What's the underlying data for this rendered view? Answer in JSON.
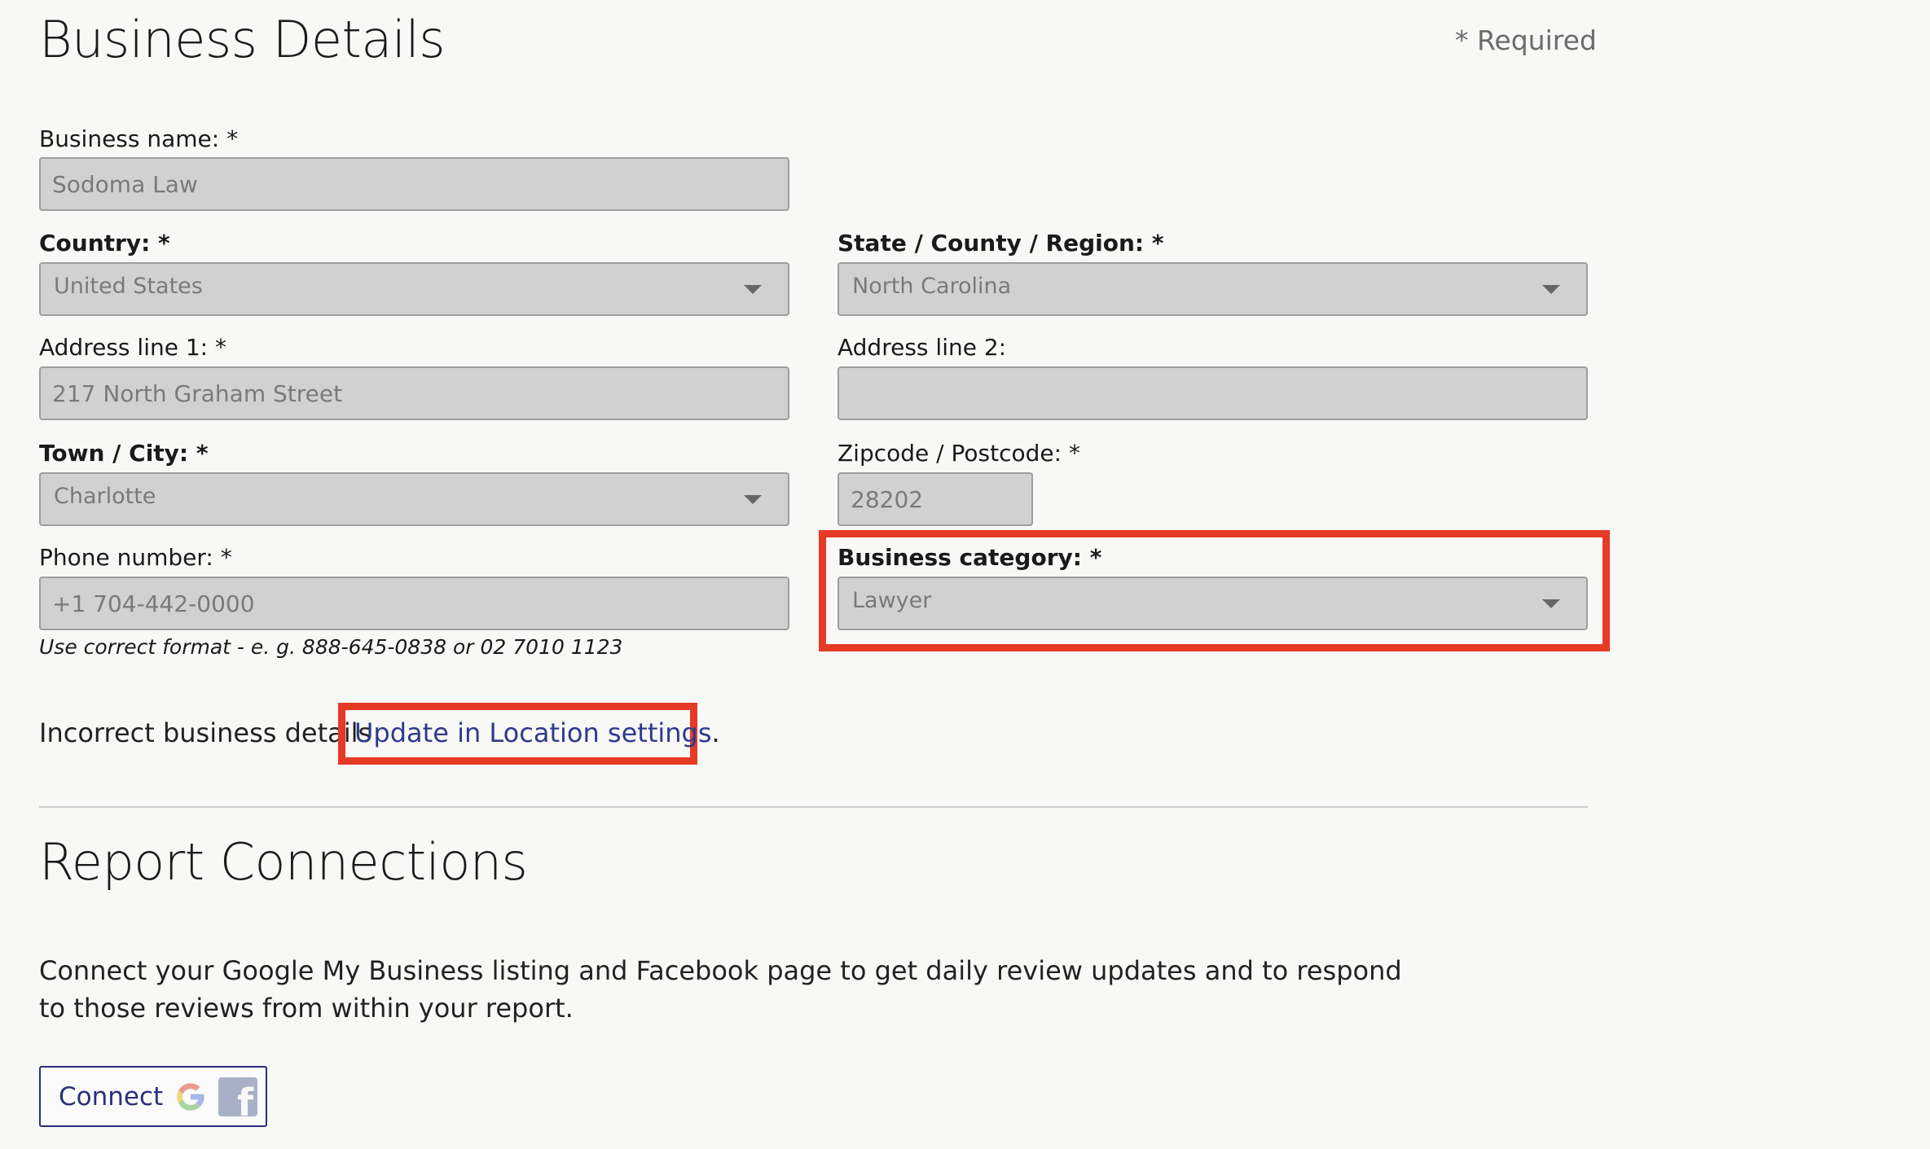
{
  "business_details": {
    "title": "Business Details",
    "required_note": "* Required",
    "business_name": {
      "label": "Business name: *",
      "value": "Sodoma Law"
    },
    "country": {
      "label": "Country: *",
      "value": "United States"
    },
    "state": {
      "label": "State / County / Region: *",
      "value": "North Carolina"
    },
    "address1": {
      "label": "Address line 1: *",
      "value": "217 North Graham Street"
    },
    "address2": {
      "label": "Address line 2:",
      "value": ""
    },
    "city": {
      "label": "Town / City: *",
      "value": "Charlotte"
    },
    "zipcode": {
      "label": "Zipcode / Postcode: *",
      "value": "28202"
    },
    "phone": {
      "label": "Phone number: *",
      "value": "+1 704-442-0000",
      "hint": "Use correct format - e. g. 888-645-0838 or 02 7010 1123"
    },
    "category": {
      "label": "Business category: *",
      "value": "Lawyer"
    },
    "incorrect_text": "Incorrect business details",
    "update_link": "Update in Location settings",
    "update_period": "."
  },
  "report_connections": {
    "title": "Report Connections",
    "description": "Connect your Google My Business listing and Facebook page to get daily review updates and to respond to those reviews from within your report.",
    "connect_label": "Connect",
    "icons": [
      "google-icon",
      "facebook-icon"
    ]
  },
  "colors": {
    "highlight": "#e53a25",
    "link": "#2d3a8c",
    "field_bg": "#d1d1d1"
  }
}
